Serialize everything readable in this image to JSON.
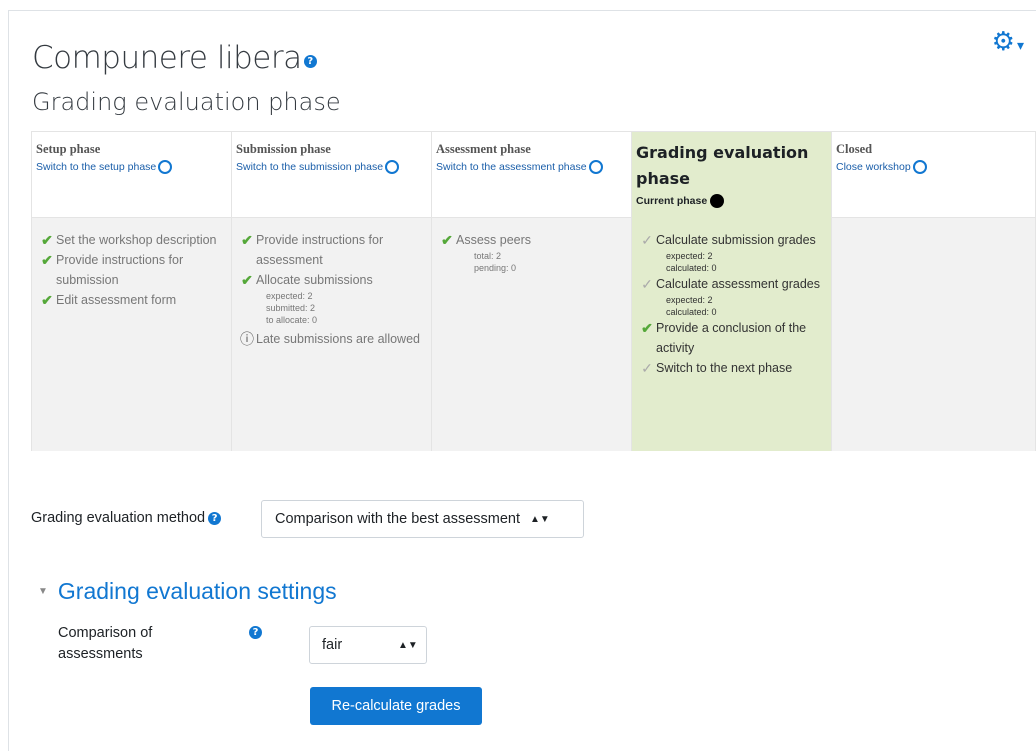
{
  "page": {
    "title": "Compunere libera",
    "subtitle": "Grading evaluation phase"
  },
  "phases": [
    {
      "name": "Setup phase",
      "link": "Switch to the setup phase"
    },
    {
      "name": "Submission phase",
      "link": "Switch to the submission phase"
    },
    {
      "name": "Assessment phase",
      "link": "Switch to the assessment phase"
    },
    {
      "name": "Grading evaluation phase",
      "current_label": "Current phase"
    },
    {
      "name": "Closed",
      "link": "Close workshop"
    }
  ],
  "setup_tasks": [
    "Set the workshop description",
    "Provide instructions for submission",
    "Edit assessment form"
  ],
  "submission_tasks": {
    "t1": "Provide instructions for assessment",
    "t2": "Allocate submissions",
    "t2_details": [
      "expected: 2",
      "submitted: 2",
      "to allocate: 0"
    ],
    "info": "Late submissions are allowed"
  },
  "assessment_tasks": {
    "t1": "Assess peers",
    "details": [
      "total: 2",
      "pending: 0"
    ]
  },
  "grading_tasks": {
    "t1": "Calculate submission grades",
    "t1_details": [
      "expected: 2",
      "calculated: 0"
    ],
    "t2": "Calculate assessment grades",
    "t2_details": [
      "expected: 2",
      "calculated: 0"
    ],
    "t3": "Provide a conclusion of the activity",
    "t4": "Switch to the next phase"
  },
  "form": {
    "method_label": "Grading evaluation method",
    "method_value": "Comparison with the best assessment",
    "section_title": "Grading evaluation settings",
    "comparison_label": "Comparison of assessments",
    "comparison_value": "fair",
    "recalc_button": "Re-calculate grades"
  },
  "colors": {
    "accent": "#1177d1",
    "active_phase_bg": "#e2eccd",
    "done_check": "#55a83a"
  },
  "icons": {
    "help": "question-circle-icon",
    "settings": "gear-icon",
    "done": "check-icon",
    "todo": "dashed-check-icon",
    "info": "info-circle-icon"
  }
}
